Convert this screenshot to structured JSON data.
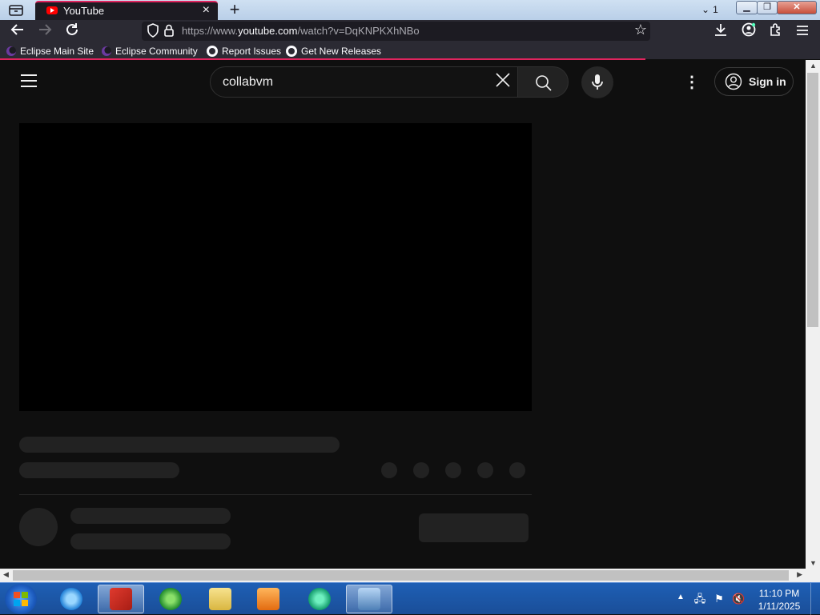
{
  "browser": {
    "tab": {
      "title": "YouTube"
    },
    "tab_count": "1",
    "url_prefix": "https://www.",
    "url_domain": "youtube.com",
    "url_path": "/watch?v=DqKNPKXhNBo",
    "bookmarks": [
      {
        "label": "Eclipse Main Site"
      },
      {
        "label": "Eclipse Community"
      },
      {
        "label": "Report Issues"
      },
      {
        "label": "Get New Releases"
      }
    ]
  },
  "youtube": {
    "search_value": "collabvm",
    "sign_in_label": "Sign in",
    "colors": {
      "background": "#0f0f0f",
      "skeleton": "#222222",
      "brand_red": "#ff0000"
    }
  },
  "taskbar": {
    "apps": [
      "start-orb",
      "gcompris-app",
      "ie-app",
      "torrent-app",
      "explorer-app",
      "media-player-app",
      "chat-app",
      "remote-desktop-app"
    ],
    "clock_time": "11:10 PM",
    "clock_date": "1/11/2025"
  }
}
